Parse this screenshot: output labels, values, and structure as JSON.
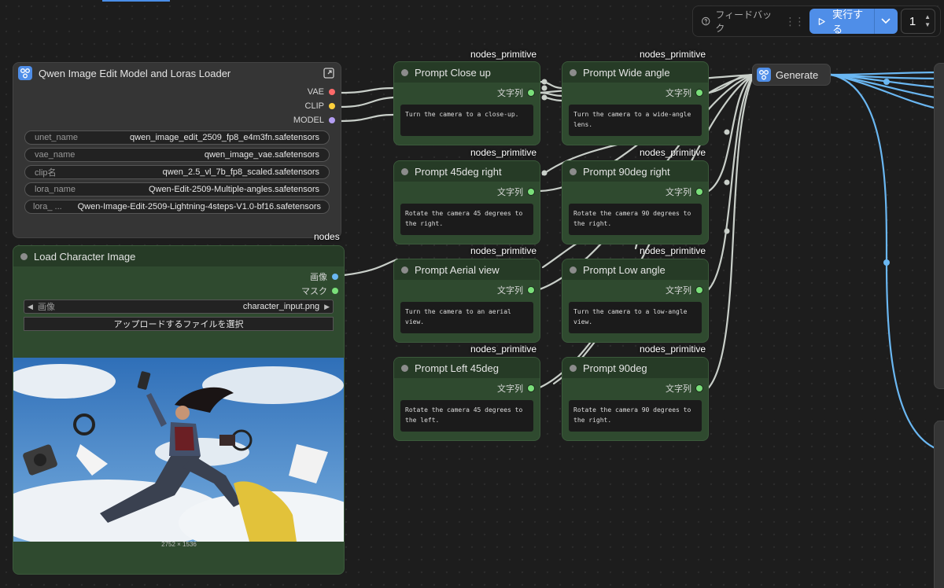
{
  "toolbar": {
    "feedback_label": "フィードバック",
    "run_label": "実行する",
    "queue_count": "1"
  },
  "loader_node": {
    "title": "Qwen Image Edit Model and Loras Loader",
    "outputs": [
      "VAE",
      "CLIP",
      "MODEL"
    ],
    "widgets": [
      {
        "label": "unet_name",
        "value": "qwen_image_edit_2509_fp8_e4m3fn.safetensors"
      },
      {
        "label": "vae_name",
        "value": "qwen_image_vae.safetensors"
      },
      {
        "label": "clip名",
        "value": "qwen_2.5_vl_7b_fp8_scaled.safetensors"
      },
      {
        "label": "lora_name",
        "value": "Qwen-Edit-2509-Multiple-angles.safetensors"
      },
      {
        "label": "lora_ ...",
        "value": "Qwen-Image-Edit-2509-Lightning-4steps-V1.0-bf16.safetensors"
      }
    ],
    "tag": "nodes"
  },
  "image_node": {
    "title": "Load Character Image",
    "outputs": [
      "画像",
      "マスク"
    ],
    "image_widget_label": "画像",
    "image_widget_value": "character_input.png",
    "upload_label": "アップロードするファイルを選択",
    "dimensions": "2752 × 1536"
  },
  "prompt_nodes": [
    {
      "tag": "nodes_primitive",
      "title": "Prompt Close up",
      "output": "文字列",
      "text": "Turn the camera to a close-up."
    },
    {
      "tag": "nodes_primitive",
      "title": "Prompt Wide angle",
      "output": "文字列",
      "text": "Turn the camera to a wide-angle lens."
    },
    {
      "tag": "nodes_primitive",
      "title": "Prompt 45deg right",
      "output": "文字列",
      "text": "Rotate the camera 45 degrees to the right."
    },
    {
      "tag": "nodes_primitive",
      "title": "Prompt 90deg right",
      "output": "文字列",
      "text": "Rotate the camera 90 degrees to the right."
    },
    {
      "tag": "nodes_primitive",
      "title": "Prompt Aerial view",
      "output": "文字列",
      "text": "Turn the camera to an aerial view."
    },
    {
      "tag": "nodes_primitive",
      "title": "Prompt Low angle",
      "output": "文字列",
      "text": "Turn the camera to a low-angle view."
    },
    {
      "tag": "nodes_primitive",
      "title": "Prompt Left 45deg",
      "output": "文字列",
      "text": "Rotate the camera 45 degrees to the left."
    },
    {
      "tag": "nodes_primitive",
      "title": "Prompt 90deg",
      "output": "文字列",
      "text": "Rotate the camera 90 degrees to the right."
    }
  ],
  "generate_node": {
    "title": "Generate"
  },
  "colors": {
    "accent": "#4f8ee8",
    "node_green": "#2f4a2f",
    "node_gray": "#353535",
    "link_gray": "#c9cfc9",
    "link_blue": "#6ab7f2"
  }
}
